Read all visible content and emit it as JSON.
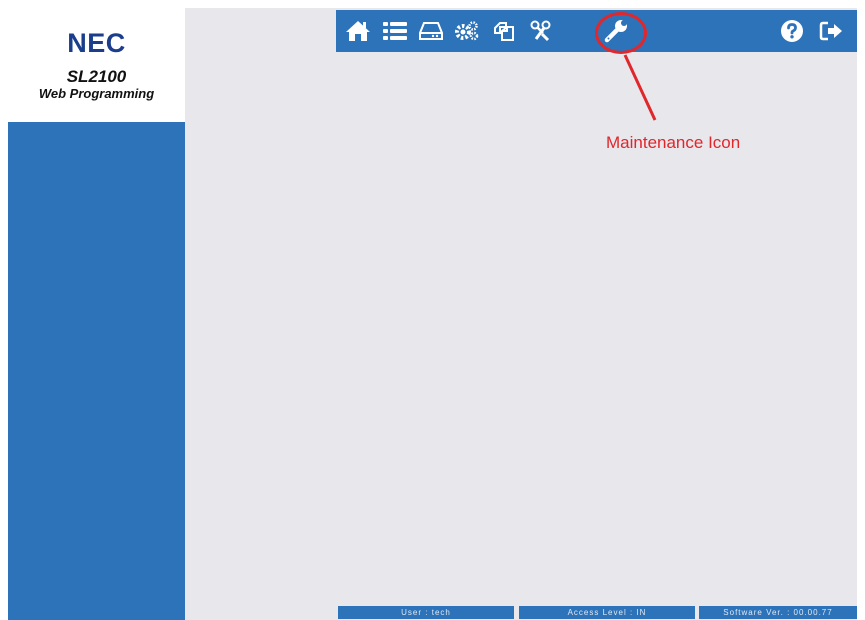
{
  "branding": {
    "brand": "NEC",
    "product": "SL2100",
    "subtitle": "Web Programming"
  },
  "toolbar": {
    "items": [
      {
        "name": "home-icon",
        "label": ""
      },
      {
        "name": "list-icon",
        "label": ""
      },
      {
        "name": "hard-drive-icon",
        "label": ""
      },
      {
        "name": "gears-icon",
        "label": ""
      },
      {
        "name": "copy-pages-icon",
        "label": ""
      },
      {
        "name": "tools-icon",
        "label": ""
      },
      {
        "name": "wrench-icon",
        "label": ""
      },
      {
        "name": "help-icon",
        "label": ""
      },
      {
        "name": "logout-icon",
        "label": ""
      }
    ]
  },
  "annotation": {
    "label": "Maintenance Icon",
    "color": "#e0272b"
  },
  "status": {
    "user": "User : tech",
    "access_level": "Access Level : IN",
    "software_version": "Software Ver. : 00.00.77"
  },
  "colors": {
    "accent": "#2d73b9",
    "brand_blue": "#1a3e8c",
    "content_bg": "#e7e7ec",
    "annotation_red": "#e0272b"
  }
}
